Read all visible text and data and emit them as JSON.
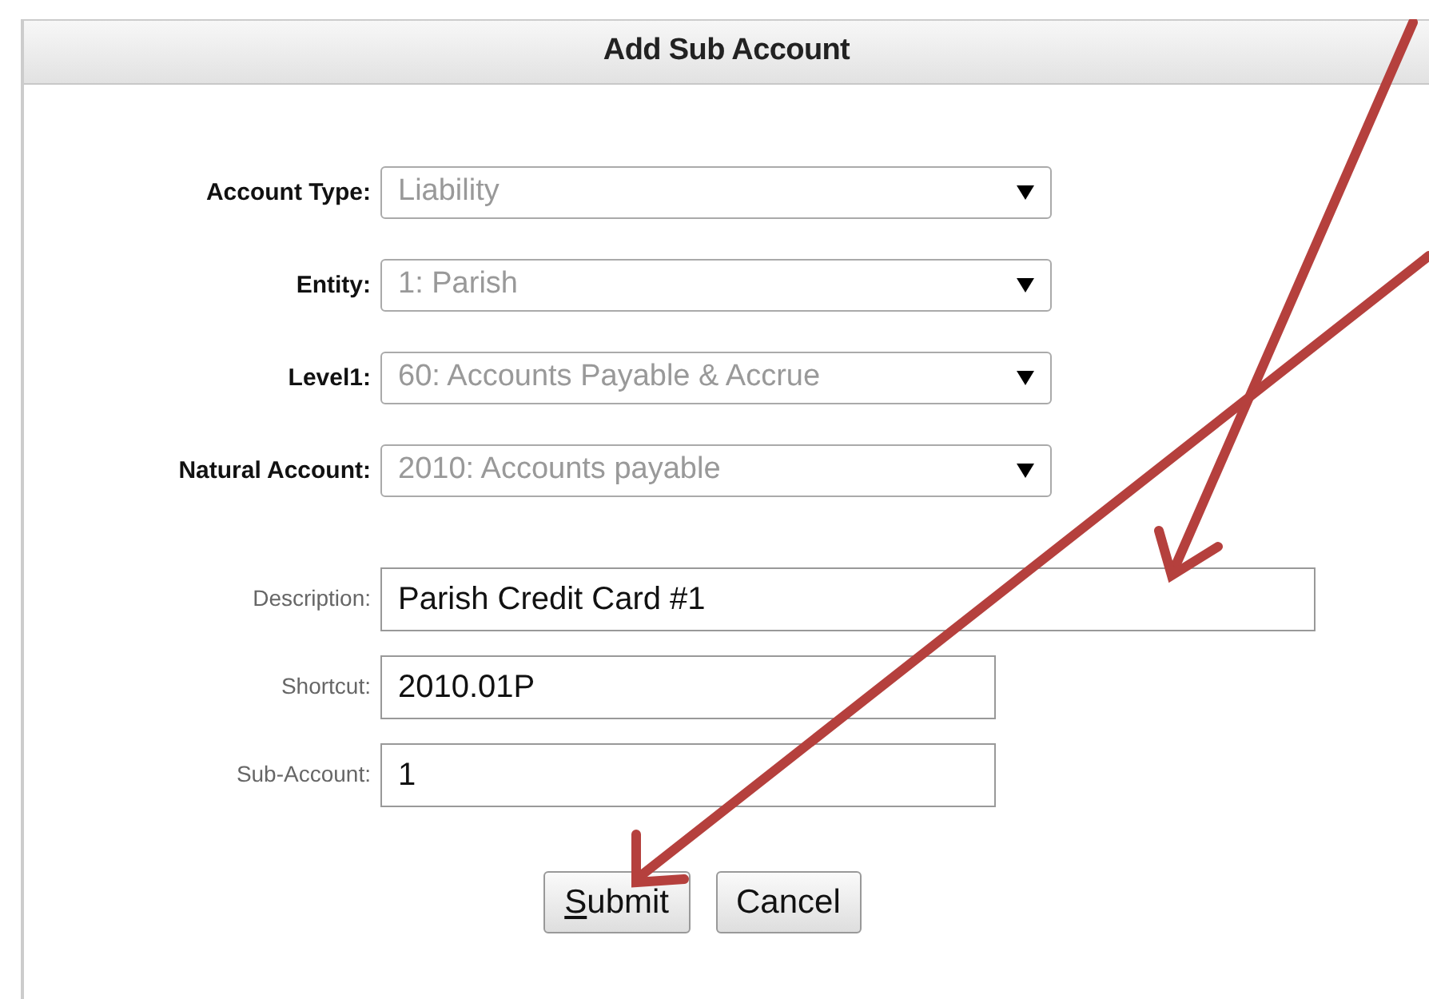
{
  "dialog": {
    "title": "Add Sub Account"
  },
  "fields": [
    {
      "kind": "select",
      "label": "Account Type:",
      "value": "Liability",
      "disabled": true
    },
    {
      "kind": "select",
      "label": "Entity:",
      "value": "1: Parish",
      "disabled": true
    },
    {
      "kind": "select",
      "label": "Level1:",
      "value": "60: Accounts Payable & Accrue",
      "disabled": true
    },
    {
      "kind": "select",
      "label": "Natural Account:",
      "value": "2010: Accounts payable",
      "disabled": true
    },
    {
      "kind": "text",
      "label": "Description:",
      "value": "Parish Credit Card #1"
    },
    {
      "kind": "shorttext",
      "label": "Shortcut:",
      "value": "2010.01P"
    },
    {
      "kind": "shorttext",
      "label": "Sub-Account:",
      "value": "1"
    }
  ],
  "buttons": [
    {
      "label": "Submit",
      "underline_first": true
    },
    {
      "label": "Cancel",
      "underline_first": false
    }
  ]
}
